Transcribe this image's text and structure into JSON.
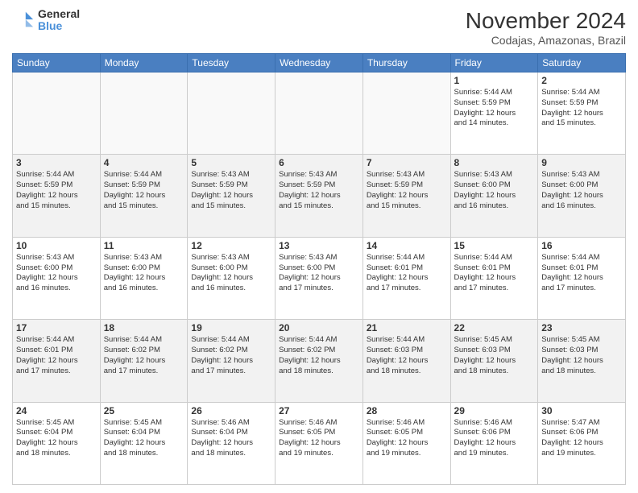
{
  "logo": {
    "general": "General",
    "blue": "Blue"
  },
  "header": {
    "month": "November 2024",
    "location": "Codajas, Amazonas, Brazil"
  },
  "weekdays": [
    "Sunday",
    "Monday",
    "Tuesday",
    "Wednesday",
    "Thursday",
    "Friday",
    "Saturday"
  ],
  "weeks": [
    [
      {
        "day": "",
        "info": ""
      },
      {
        "day": "",
        "info": ""
      },
      {
        "day": "",
        "info": ""
      },
      {
        "day": "",
        "info": ""
      },
      {
        "day": "",
        "info": ""
      },
      {
        "day": "1",
        "info": "Sunrise: 5:44 AM\nSunset: 5:59 PM\nDaylight: 12 hours\nand 14 minutes."
      },
      {
        "day": "2",
        "info": "Sunrise: 5:44 AM\nSunset: 5:59 PM\nDaylight: 12 hours\nand 15 minutes."
      }
    ],
    [
      {
        "day": "3",
        "info": "Sunrise: 5:44 AM\nSunset: 5:59 PM\nDaylight: 12 hours\nand 15 minutes."
      },
      {
        "day": "4",
        "info": "Sunrise: 5:44 AM\nSunset: 5:59 PM\nDaylight: 12 hours\nand 15 minutes."
      },
      {
        "day": "5",
        "info": "Sunrise: 5:43 AM\nSunset: 5:59 PM\nDaylight: 12 hours\nand 15 minutes."
      },
      {
        "day": "6",
        "info": "Sunrise: 5:43 AM\nSunset: 5:59 PM\nDaylight: 12 hours\nand 15 minutes."
      },
      {
        "day": "7",
        "info": "Sunrise: 5:43 AM\nSunset: 5:59 PM\nDaylight: 12 hours\nand 15 minutes."
      },
      {
        "day": "8",
        "info": "Sunrise: 5:43 AM\nSunset: 6:00 PM\nDaylight: 12 hours\nand 16 minutes."
      },
      {
        "day": "9",
        "info": "Sunrise: 5:43 AM\nSunset: 6:00 PM\nDaylight: 12 hours\nand 16 minutes."
      }
    ],
    [
      {
        "day": "10",
        "info": "Sunrise: 5:43 AM\nSunset: 6:00 PM\nDaylight: 12 hours\nand 16 minutes."
      },
      {
        "day": "11",
        "info": "Sunrise: 5:43 AM\nSunset: 6:00 PM\nDaylight: 12 hours\nand 16 minutes."
      },
      {
        "day": "12",
        "info": "Sunrise: 5:43 AM\nSunset: 6:00 PM\nDaylight: 12 hours\nand 16 minutes."
      },
      {
        "day": "13",
        "info": "Sunrise: 5:43 AM\nSunset: 6:00 PM\nDaylight: 12 hours\nand 17 minutes."
      },
      {
        "day": "14",
        "info": "Sunrise: 5:44 AM\nSunset: 6:01 PM\nDaylight: 12 hours\nand 17 minutes."
      },
      {
        "day": "15",
        "info": "Sunrise: 5:44 AM\nSunset: 6:01 PM\nDaylight: 12 hours\nand 17 minutes."
      },
      {
        "day": "16",
        "info": "Sunrise: 5:44 AM\nSunset: 6:01 PM\nDaylight: 12 hours\nand 17 minutes."
      }
    ],
    [
      {
        "day": "17",
        "info": "Sunrise: 5:44 AM\nSunset: 6:01 PM\nDaylight: 12 hours\nand 17 minutes."
      },
      {
        "day": "18",
        "info": "Sunrise: 5:44 AM\nSunset: 6:02 PM\nDaylight: 12 hours\nand 17 minutes."
      },
      {
        "day": "19",
        "info": "Sunrise: 5:44 AM\nSunset: 6:02 PM\nDaylight: 12 hours\nand 17 minutes."
      },
      {
        "day": "20",
        "info": "Sunrise: 5:44 AM\nSunset: 6:02 PM\nDaylight: 12 hours\nand 18 minutes."
      },
      {
        "day": "21",
        "info": "Sunrise: 5:44 AM\nSunset: 6:03 PM\nDaylight: 12 hours\nand 18 minutes."
      },
      {
        "day": "22",
        "info": "Sunrise: 5:45 AM\nSunset: 6:03 PM\nDaylight: 12 hours\nand 18 minutes."
      },
      {
        "day": "23",
        "info": "Sunrise: 5:45 AM\nSunset: 6:03 PM\nDaylight: 12 hours\nand 18 minutes."
      }
    ],
    [
      {
        "day": "24",
        "info": "Sunrise: 5:45 AM\nSunset: 6:04 PM\nDaylight: 12 hours\nand 18 minutes."
      },
      {
        "day": "25",
        "info": "Sunrise: 5:45 AM\nSunset: 6:04 PM\nDaylight: 12 hours\nand 18 minutes."
      },
      {
        "day": "26",
        "info": "Sunrise: 5:46 AM\nSunset: 6:04 PM\nDaylight: 12 hours\nand 18 minutes."
      },
      {
        "day": "27",
        "info": "Sunrise: 5:46 AM\nSunset: 6:05 PM\nDaylight: 12 hours\nand 19 minutes."
      },
      {
        "day": "28",
        "info": "Sunrise: 5:46 AM\nSunset: 6:05 PM\nDaylight: 12 hours\nand 19 minutes."
      },
      {
        "day": "29",
        "info": "Sunrise: 5:46 AM\nSunset: 6:06 PM\nDaylight: 12 hours\nand 19 minutes."
      },
      {
        "day": "30",
        "info": "Sunrise: 5:47 AM\nSunset: 6:06 PM\nDaylight: 12 hours\nand 19 minutes."
      }
    ]
  ]
}
